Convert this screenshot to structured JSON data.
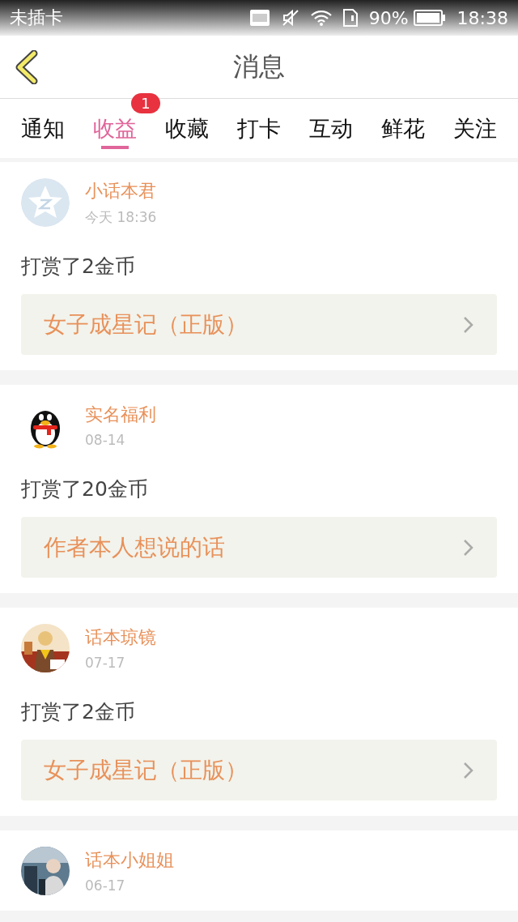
{
  "status_bar": {
    "carrier": "未插卡",
    "battery": "90%",
    "time": "18:38"
  },
  "header": {
    "title": "消息"
  },
  "tabs": [
    {
      "label": "通知",
      "selected": false
    },
    {
      "label": "收益",
      "selected": true,
      "badge": "1"
    },
    {
      "label": "收藏",
      "selected": false
    },
    {
      "label": "打卡",
      "selected": false
    },
    {
      "label": "互动",
      "selected": false
    },
    {
      "label": "鲜花",
      "selected": false
    },
    {
      "label": "关注",
      "selected": false
    }
  ],
  "messages": [
    {
      "kind": "star",
      "name": "小话本君",
      "time": "今天 18:36",
      "text": "打赏了2金币",
      "link": "女子成星记（正版）"
    },
    {
      "kind": "penguin",
      "name": "实名福利",
      "time": "08-14",
      "text": "打赏了20金币",
      "link": "作者本人想说的话"
    },
    {
      "kind": "picture",
      "name": "话本琼镜",
      "time": "07-17",
      "text": "打赏了2金币",
      "link": "女子成星记（正版）"
    },
    {
      "kind": "picture",
      "name": "话本小姐姐",
      "time": "06-17"
    }
  ]
}
